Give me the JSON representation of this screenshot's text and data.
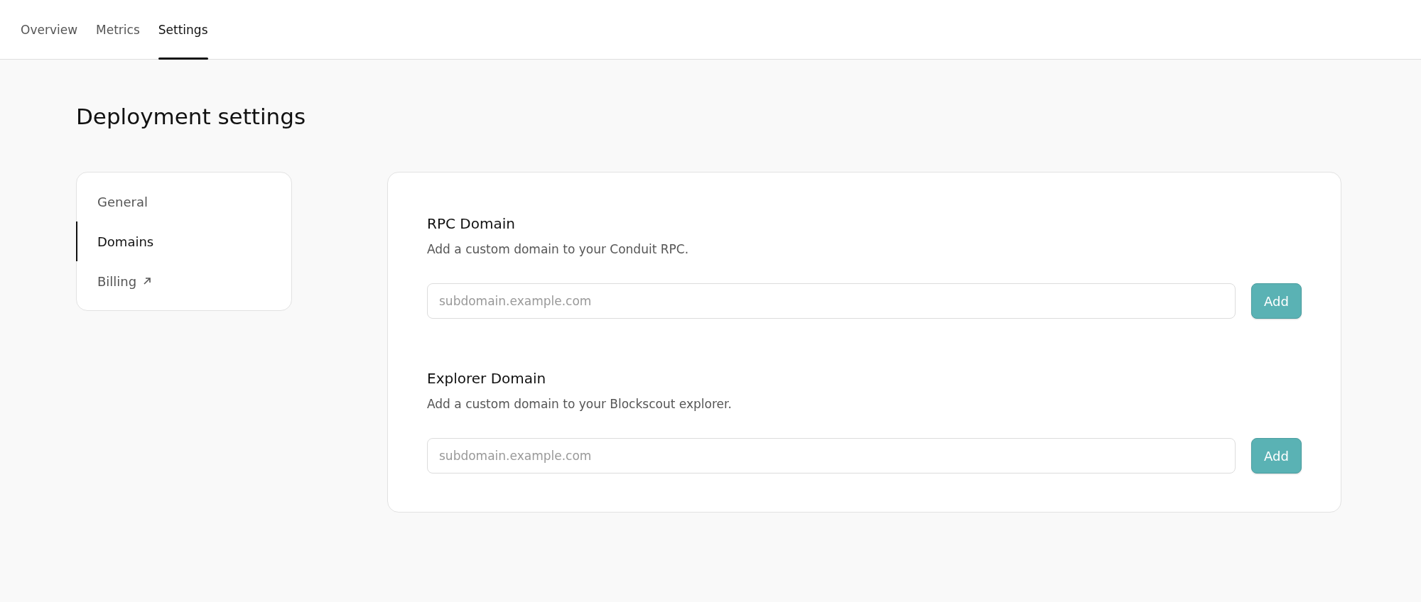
{
  "tabs": [
    {
      "label": "Overview",
      "selected": false
    },
    {
      "label": "Metrics",
      "selected": false
    },
    {
      "label": "Settings",
      "selected": true
    }
  ],
  "page_title": "Deployment settings",
  "sidebar": {
    "items": [
      {
        "label": "General",
        "selected": false,
        "external": false
      },
      {
        "label": "Domains",
        "selected": true,
        "external": false
      },
      {
        "label": "Billing",
        "selected": false,
        "external": true
      }
    ]
  },
  "sections": [
    {
      "title": "RPC Domain",
      "description": "Add a custom domain to your Conduit RPC.",
      "placeholder": "subdomain.example.com",
      "button": "Add"
    },
    {
      "title": "Explorer Domain",
      "description": "Add a custom domain to your Blockscout explorer.",
      "placeholder": "subdomain.example.com",
      "button": "Add"
    }
  ]
}
